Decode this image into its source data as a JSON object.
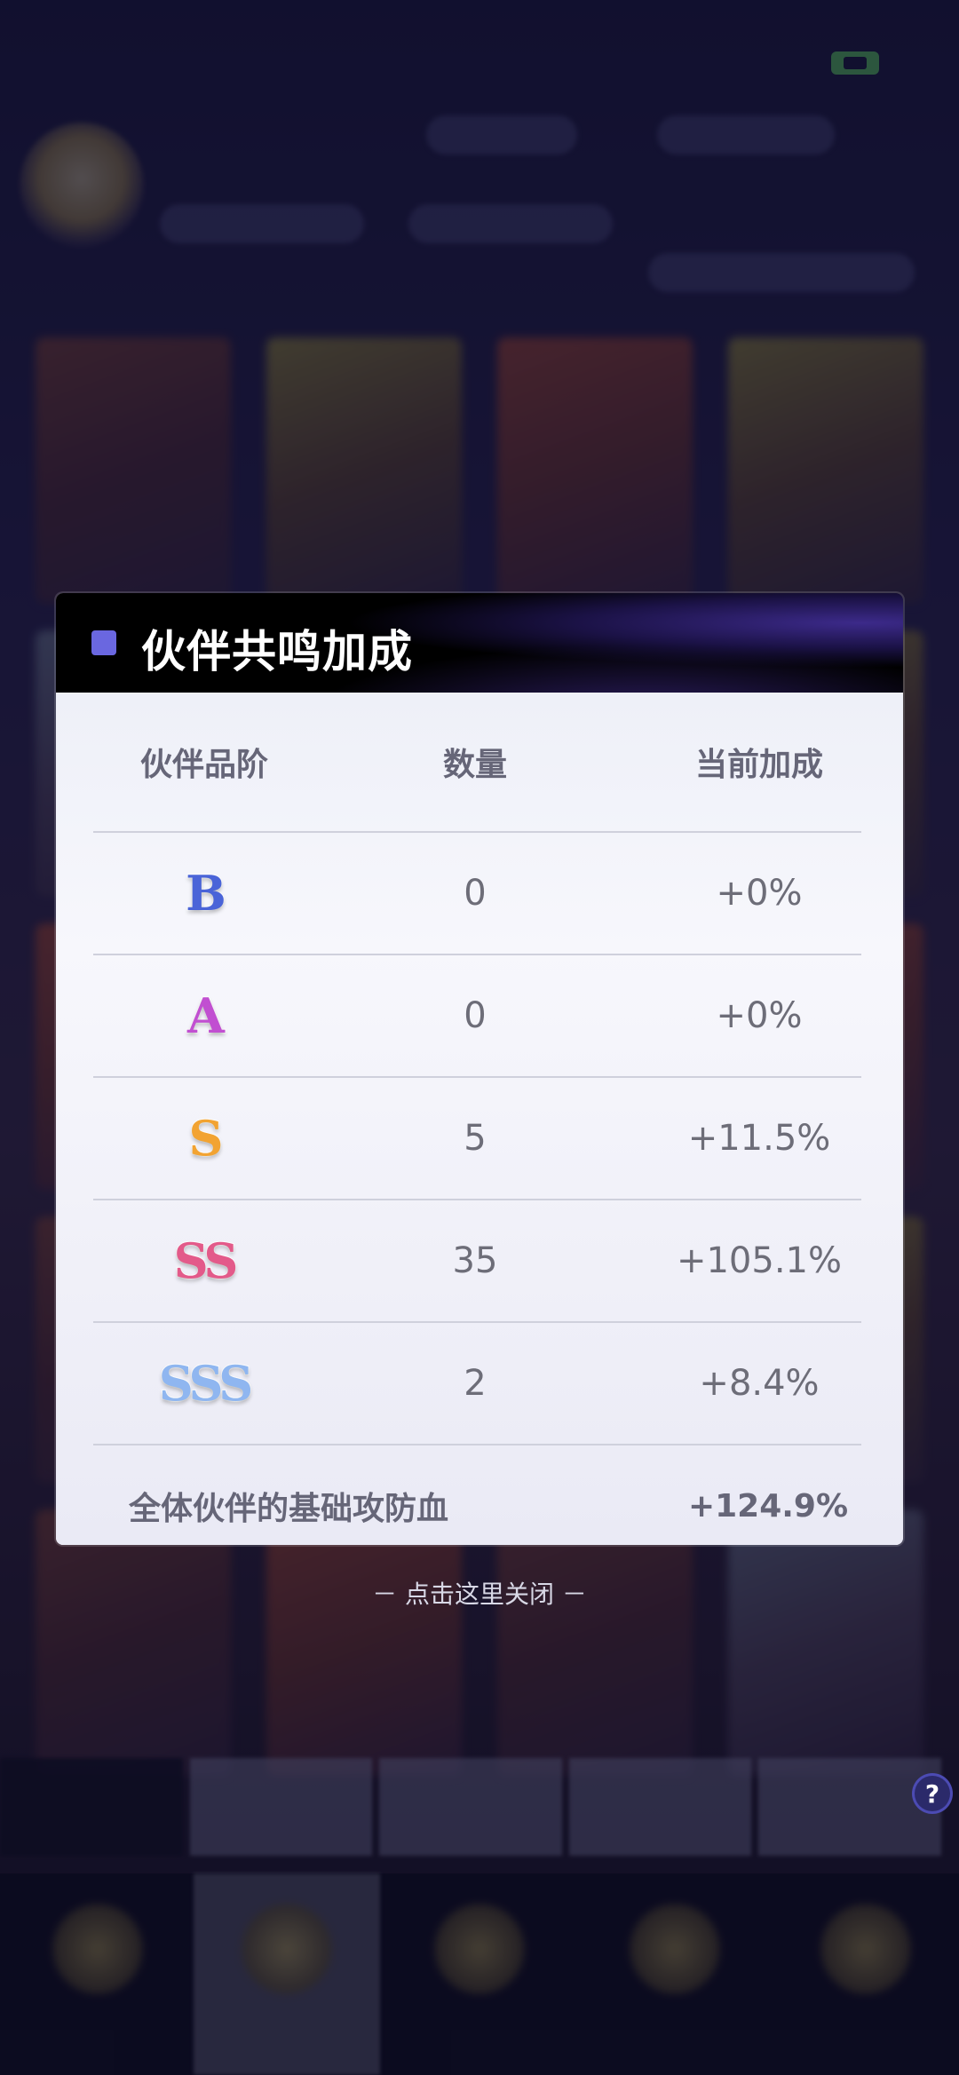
{
  "dialog": {
    "title": "伙伴共鸣加成",
    "columns": [
      "伙伴品阶",
      "数量",
      "当前加成"
    ],
    "rows": [
      {
        "grade": "B",
        "count": "0",
        "bonus": "+0%"
      },
      {
        "grade": "A",
        "count": "0",
        "bonus": "+0%"
      },
      {
        "grade": "S",
        "count": "5",
        "bonus": "+11.5%"
      },
      {
        "grade": "SS",
        "count": "35",
        "bonus": "+105.1%"
      },
      {
        "grade": "SSS",
        "count": "2",
        "bonus": "+8.4%"
      }
    ],
    "total": {
      "label": "全体伙伴的基础攻防血",
      "value": "+124.9%"
    }
  },
  "close_hint": "－ 点击这里关闭 －",
  "help_button": "?",
  "colors": {
    "accent": "#6a67e0",
    "grade_b": "#4a64d8",
    "grade_a": "#c14fd1",
    "grade_s": "#f2a332",
    "grade_ss": "#e35a8a",
    "grade_sss": "#8fb6f0"
  }
}
